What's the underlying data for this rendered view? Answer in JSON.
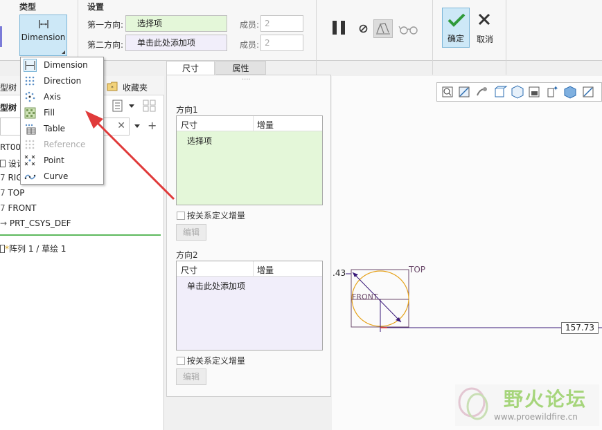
{
  "ribbon": {
    "type_group_label": "类型",
    "settings_group_label": "设置",
    "type_button_label": "Dimension",
    "first_direction_label": "第一方向:",
    "first_direction_value": "选择项",
    "second_direction_label": "第二方向:",
    "second_direction_value": "单击此处添加项",
    "members_label_1": "成员:",
    "members_value_1": "2",
    "members_label_2": "成员:",
    "members_value_2": "2",
    "ok_label": "确定",
    "cancel_label": "取消"
  },
  "tabs": {
    "size": "尺寸",
    "properties": "属性"
  },
  "type_menu": {
    "items": [
      {
        "label": "Dimension",
        "icon": "dimension-icon",
        "enabled": true
      },
      {
        "label": "Direction",
        "icon": "direction-icon",
        "enabled": true
      },
      {
        "label": "Axis",
        "icon": "axis-icon",
        "enabled": true
      },
      {
        "label": "Fill",
        "icon": "fill-icon",
        "enabled": true
      },
      {
        "label": "Table",
        "icon": "table-icon",
        "enabled": true
      },
      {
        "label": "Reference",
        "icon": "reference-icon",
        "enabled": false
      },
      {
        "label": "Point",
        "icon": "point-icon",
        "enabled": true
      },
      {
        "label": "Curve",
        "icon": "curve-icon",
        "enabled": true
      }
    ]
  },
  "left_panel": {
    "tab_model_tree": "型树",
    "tab_favorites": "收藏夹",
    "header_model_tree": "型树",
    "items": [
      "RT00",
      "设计",
      "RIG",
      "TOP",
      "FRONT",
      "PRT_CSYS_DEF"
    ],
    "feature_item": "阵列 1 / 草绘 1"
  },
  "center_panel": {
    "direction1_label": "方向1",
    "direction2_label": "方向2",
    "col_size": "尺寸",
    "col_increment": "增量",
    "dir1_cell": "选择项",
    "dir2_cell": "单击此处添加项",
    "relation_checkbox_label": "按关系定义增量",
    "edit_button": "编辑",
    "dots": "····"
  },
  "graphics": {
    "dim_left": ".43",
    "dim_right": "157.73",
    "plane_top": "TOP",
    "plane_front": "FRONT"
  },
  "watermark": {
    "title": "野火论坛",
    "url": "www.proewildfire.cn"
  },
  "colors": {
    "accent_blue": "#cde8f7",
    "first_dir_bg": "#e4f7d9",
    "second_dir_bg": "#f1eefa",
    "arrow_red": "#e03a3a",
    "sketch_orange": "#e6a21a",
    "sketch_purple": "#3a1a7a"
  }
}
